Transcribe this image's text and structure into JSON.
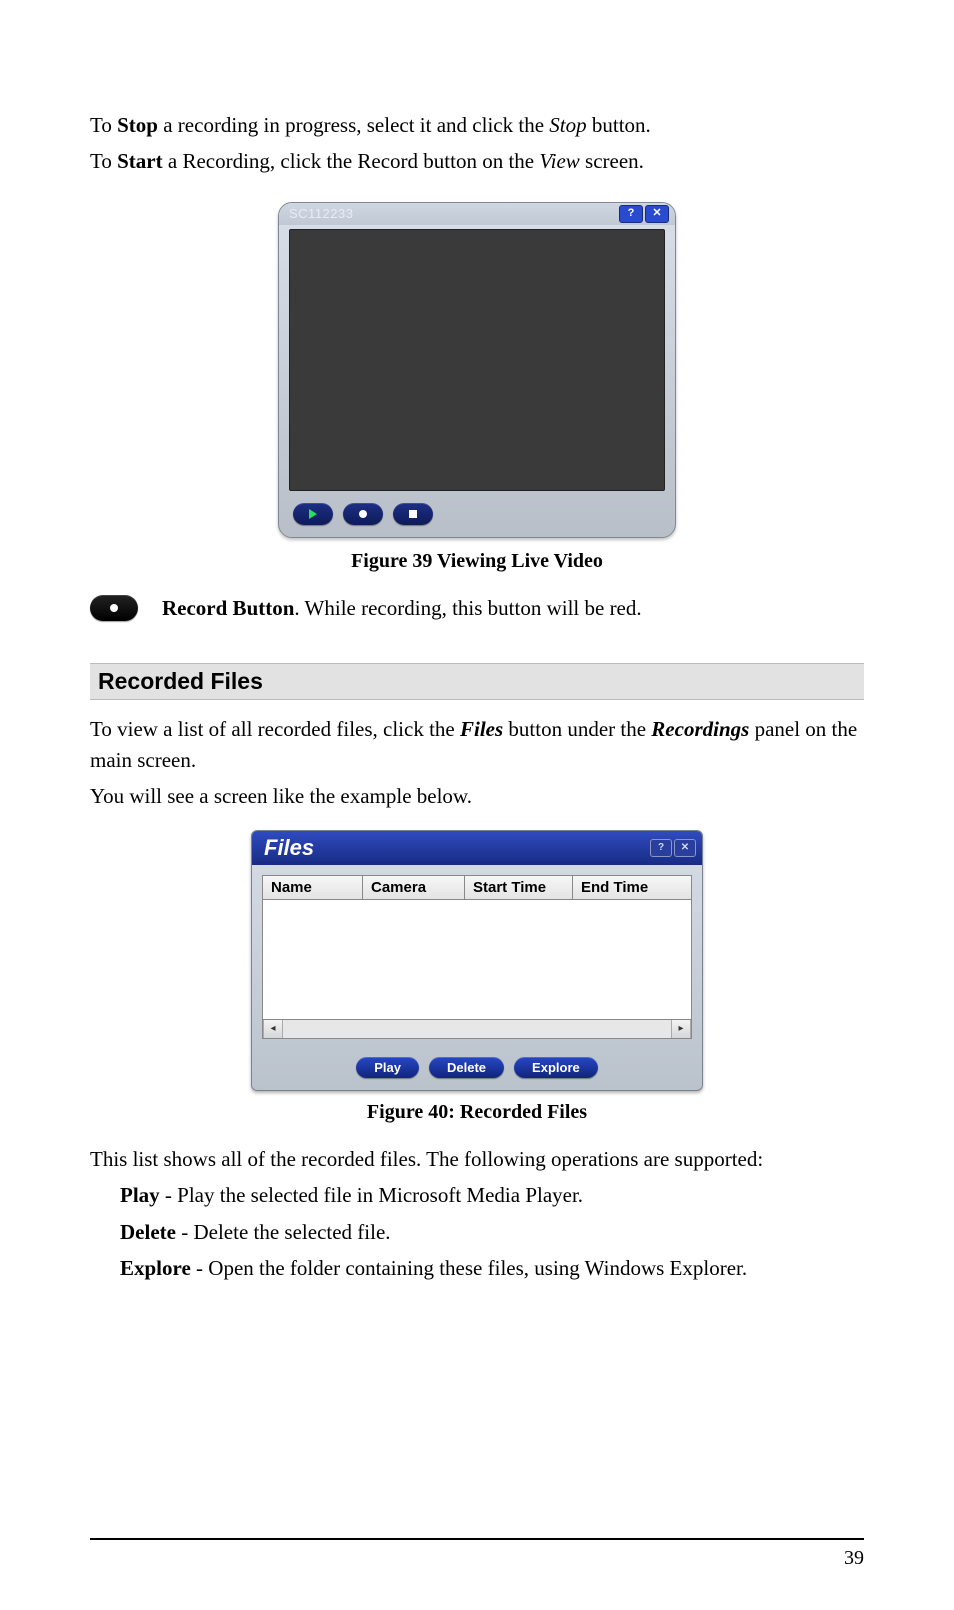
{
  "para1": {
    "pre": "To ",
    "b1": "Stop",
    "mid": " a recording in progress, select it and click the ",
    "i1": "Stop",
    "post": " button."
  },
  "para2": {
    "pre": "To ",
    "b1": "Start",
    "mid": " a Recording, click the Record button on the ",
    "i1": "View",
    "post": " screen."
  },
  "viewer": {
    "title": "SC112233",
    "help_glyph": "?",
    "close_glyph": "✕"
  },
  "caption39": "Figure 39 Viewing Live Video",
  "record_row": {
    "b": "Record Button",
    "rest": ". While recording, this button will be red."
  },
  "section_heading": "Recorded Files",
  "para3": {
    "pre": "To view a list of all recorded files, click the ",
    "i1": "Files",
    "mid": " button under the ",
    "i2": "Recordings",
    "post": " panel on the main screen."
  },
  "para4": "You will see a screen like the example below.",
  "files": {
    "title": "Files",
    "help_glyph": "?",
    "close_glyph": "✕",
    "headers": {
      "name": "Name",
      "camera": "Camera",
      "start": "Start Time",
      "end": "End Time"
    },
    "scroll_left": "◂",
    "scroll_right": "▸",
    "buttons": {
      "play": "Play",
      "delete": "Delete",
      "explore": "Explore"
    }
  },
  "caption40": "Figure 40: Recorded Files",
  "para5": "This list shows all of the recorded files. The following operations are supported:",
  "ops": {
    "play": {
      "b": "Play",
      "rest": " - Play the selected file in Microsoft Media Player."
    },
    "delete": {
      "b": "Delete",
      "rest": " - Delete the selected file."
    },
    "explore": {
      "b": "Explore",
      "rest": " - Open the folder containing these files, using Windows Explorer."
    }
  },
  "page_number": "39"
}
